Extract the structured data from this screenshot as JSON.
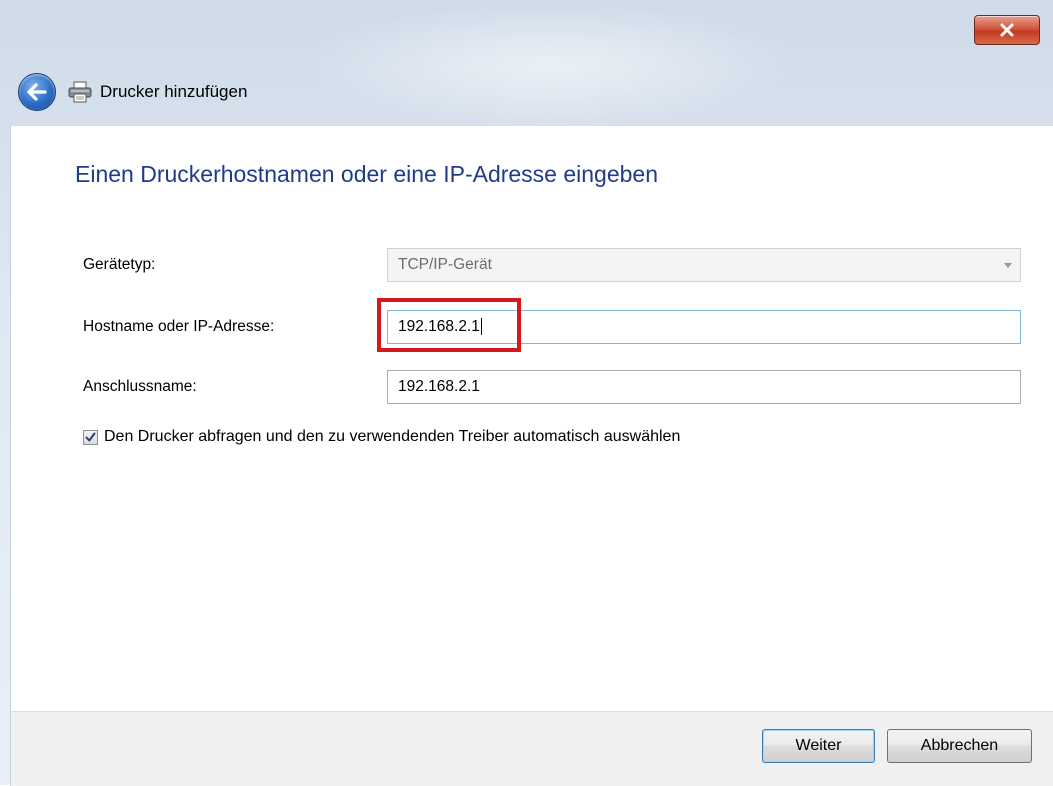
{
  "window": {
    "title": "Drucker hinzufügen",
    "close_icon": "close-icon"
  },
  "heading": "Einen Druckerhostnamen oder eine IP-Adresse eingeben",
  "form": {
    "device_type": {
      "label": "Gerätetyp:",
      "value": "TCP/IP-Gerät"
    },
    "hostname": {
      "label": "Hostname oder IP-Adresse:",
      "value": "192.168.2.1"
    },
    "port_name": {
      "label": "Anschlussname:",
      "value": "192.168.2.1"
    },
    "auto_driver": {
      "label": "Den Drucker abfragen und den zu verwendenden Treiber automatisch auswählen",
      "checked": true
    }
  },
  "buttons": {
    "next": "Weiter",
    "cancel": "Abbrechen"
  },
  "colors": {
    "heading": "#1f3b8c",
    "highlight": "#d3191d",
    "close": "#c23a20"
  }
}
